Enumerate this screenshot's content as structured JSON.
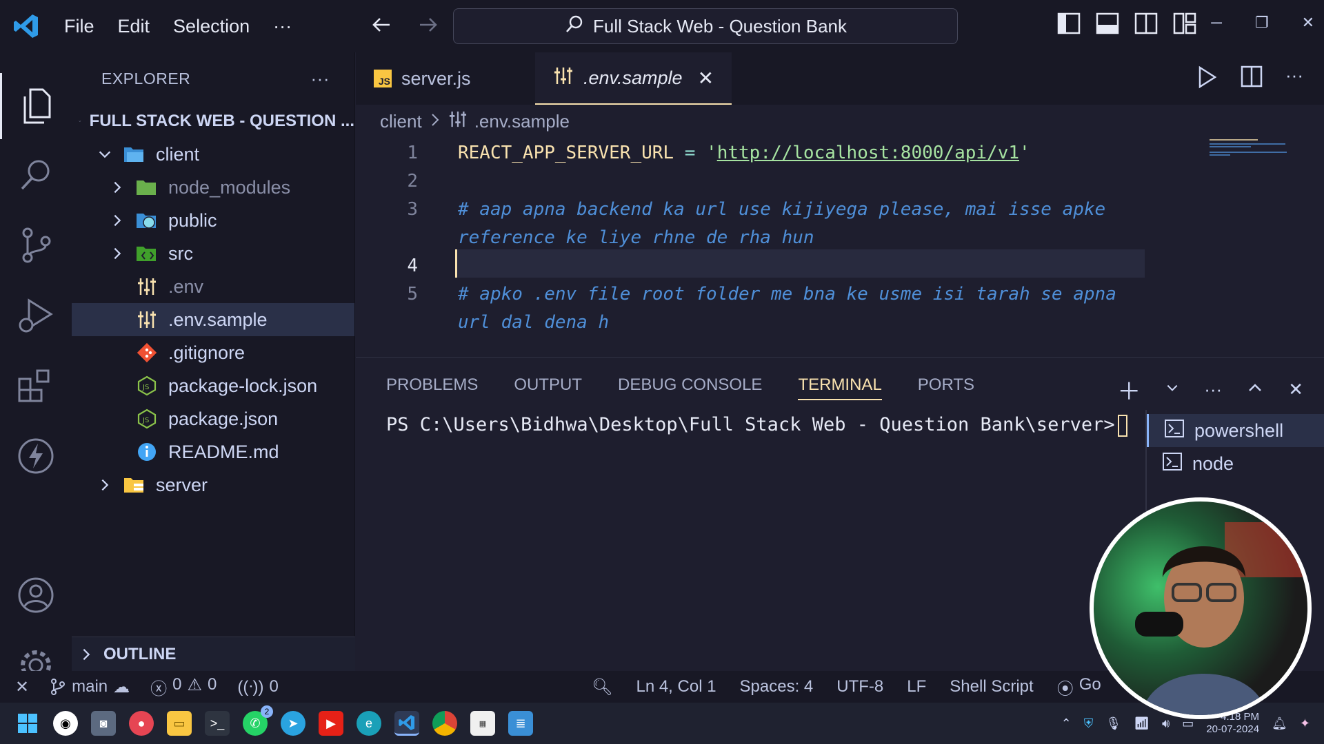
{
  "titlebar": {
    "menu": [
      "File",
      "Edit",
      "Selection",
      "···"
    ],
    "search_text": "Full Stack Web - Question Bank"
  },
  "sidebar": {
    "header": "EXPLORER",
    "project": "FULL STACK WEB - QUESTION ...",
    "tree": [
      {
        "label": "client",
        "kind": "folder-open"
      },
      {
        "label": "node_modules",
        "kind": "folder"
      },
      {
        "label": "public",
        "kind": "folder"
      },
      {
        "label": "src",
        "kind": "folder"
      },
      {
        "label": ".env",
        "kind": "file"
      },
      {
        "label": ".env.sample",
        "kind": "file"
      },
      {
        "label": ".gitignore",
        "kind": "file"
      },
      {
        "label": "package-lock.json",
        "kind": "file"
      },
      {
        "label": "package.json",
        "kind": "file"
      },
      {
        "label": "README.md",
        "kind": "file"
      },
      {
        "label": "server",
        "kind": "folder"
      }
    ],
    "outline": "OUTLINE"
  },
  "editor": {
    "tabs": [
      {
        "label": "server.js",
        "active": false
      },
      {
        "label": ".env.sample",
        "active": true
      }
    ],
    "breadcrumb": [
      "client",
      ".env.sample"
    ],
    "line_numbers": [
      "1",
      "2",
      "3",
      "4",
      "5"
    ],
    "line1_key": "REACT_APP_SERVER_URL",
    "line1_op": " = ",
    "line1_quote_open": "'",
    "line1_url": "http://localhost:8000/api/v1",
    "line1_quote_close": "'",
    "line3a": "# aap apna backend ka url use kijiyega please, mai isse apke",
    "line3b": "reference ke liye rhne de rha hun",
    "line5a": "# apko .env file root folder me bna ke usme isi tarah se apna",
    "line5b": "url dal dena h"
  },
  "panel": {
    "tabs": [
      "PROBLEMS",
      "OUTPUT",
      "DEBUG CONSOLE",
      "TERMINAL",
      "PORTS"
    ],
    "active_tab": "TERMINAL",
    "prompt": "PS C:\\Users\\Bidhwa\\Desktop\\Full Stack Web - Question Bank\\server>",
    "terminals": [
      "powershell",
      "node"
    ]
  },
  "statusbar": {
    "branch": "main",
    "errors": "0",
    "warnings": "0",
    "ports": "0",
    "position": "Ln 4, Col 1",
    "spaces": "Spaces: 4",
    "encoding": "UTF-8",
    "eol": "LF",
    "language": "Shell Script",
    "golive": "Go"
  },
  "taskbar": {
    "time": "4:18 PM",
    "date": "20-07-2024",
    "whatsapp_badge": "2"
  },
  "colors": {
    "accent": "#f9e2af",
    "comment": "#4f8fd8",
    "string": "#a6e3a1"
  }
}
